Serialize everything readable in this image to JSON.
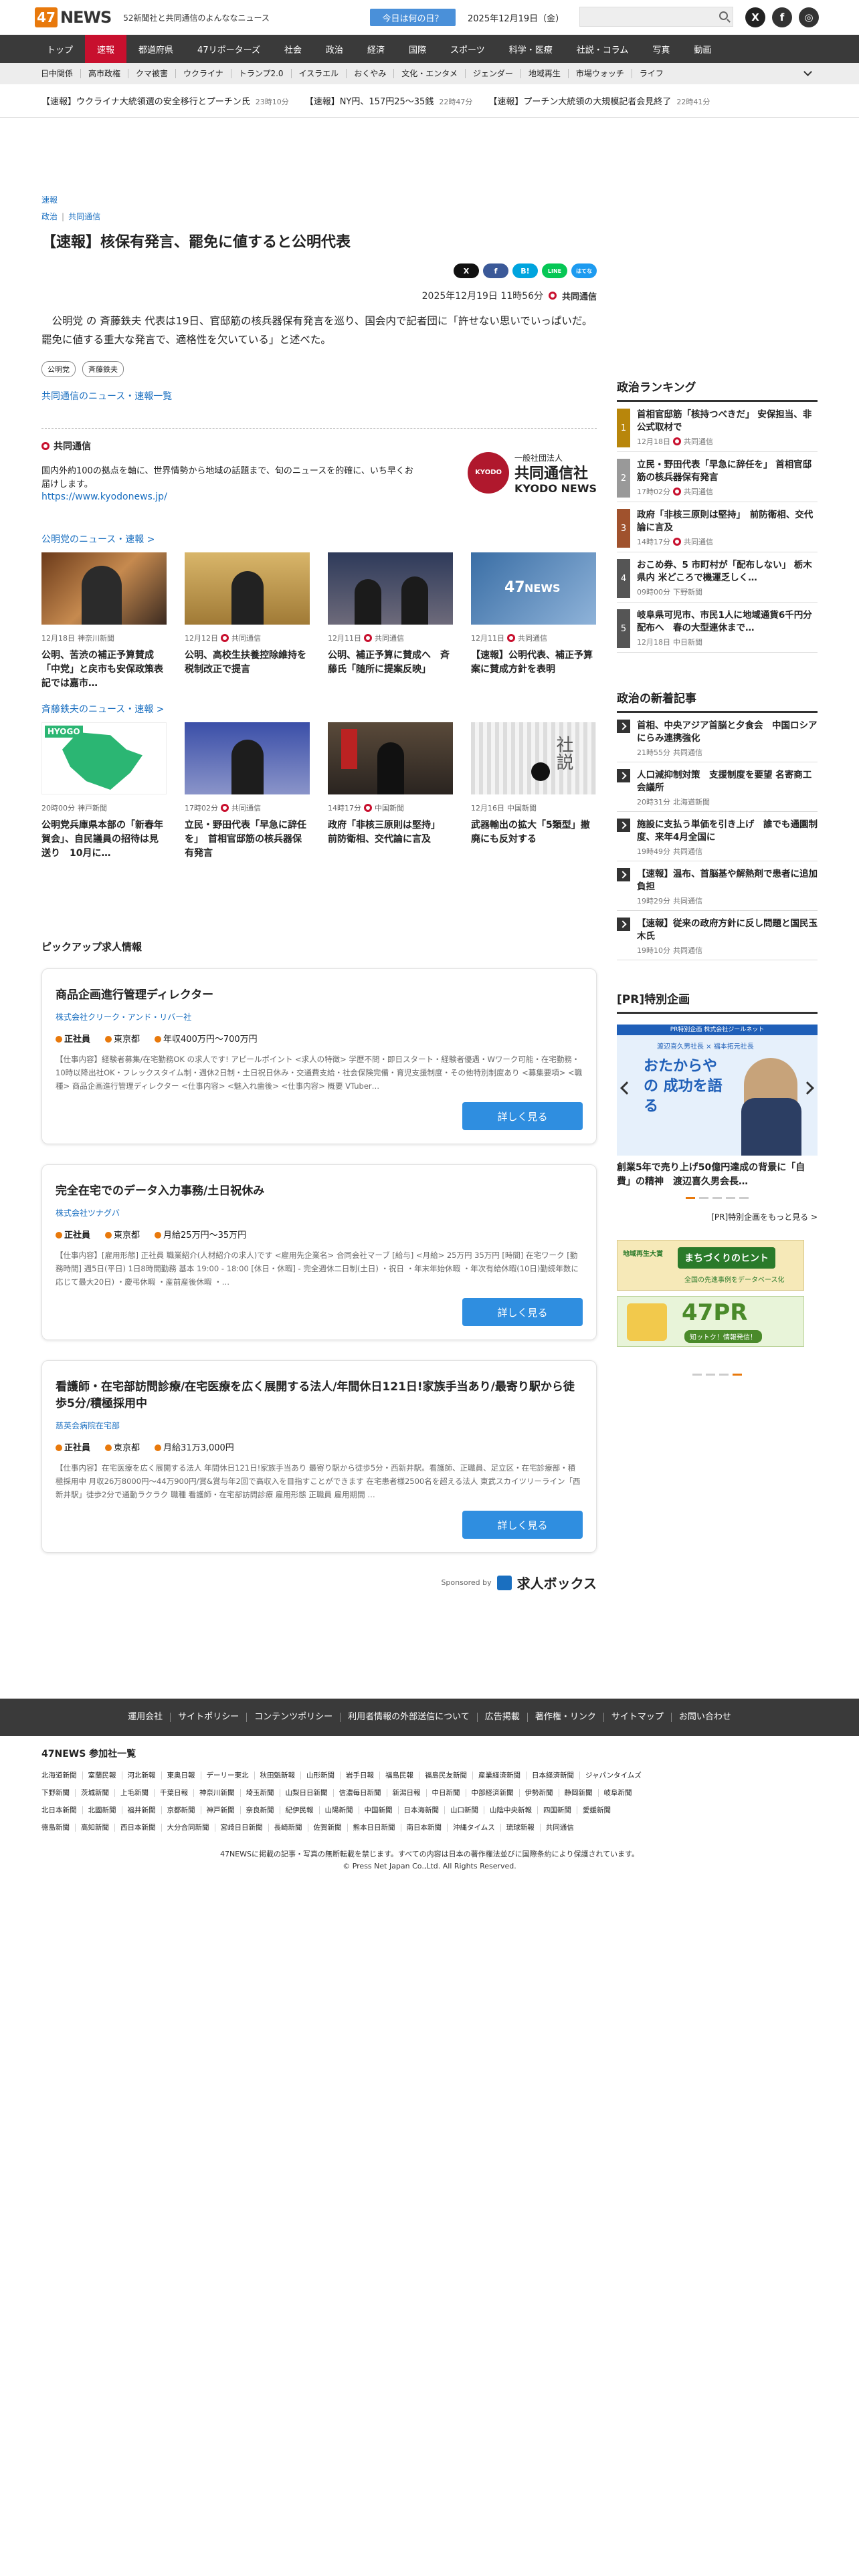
{
  "header": {
    "logo": "47",
    "logo_text": "NEWS",
    "tagline": "52新聞社と共同通信のよんななニュース",
    "today_button": "今日は何の日？",
    "date": "2025年12月19日（金）",
    "social": [
      "X",
      "f",
      "◎"
    ]
  },
  "gnav": [
    "トップ",
    "速報",
    "都道府県",
    "47リポーターズ",
    "社会",
    "政治",
    "経済",
    "国際",
    "スポーツ",
    "科学・医療",
    "社説・コラム",
    "写真",
    "動画"
  ],
  "subnav": [
    "日中関係",
    "高市政権",
    "クマ被害",
    "ウクライナ",
    "トランプ2.0",
    "イスラエル",
    "おくやみ",
    "文化・エンタメ",
    "ジェンダー",
    "地域再生",
    "市場ウォッチ",
    "ライフ"
  ],
  "ticker": [
    {
      "text": "【速報】ウクライナ大統領選の安全移行とプーチン氏",
      "time": "23時10分"
    },
    {
      "text": "【速報】NY円、157円25～35銭",
      "time": "22時47分"
    },
    {
      "text": "【速報】プーチン大統領の大規模記者会見終了",
      "time": "22時41分"
    }
  ],
  "article": {
    "category": "速報",
    "crumbs": [
      "政治",
      "共同通信"
    ],
    "title": "【速報】核保有発言、罷免に値すると公明代表",
    "share": [
      "X",
      "f",
      "B!",
      "LINE",
      "はてな"
    ],
    "date": "2025年12月19日 11時56分",
    "source": "共同通信",
    "body": "公明党 の 斉藤鉄夫 代表は19日、官邸筋の核兵器保有発言を巡り、国会内で記者団に「許せない思いでいっぱいだ。罷免に値する重大な発言で、適格性を欠いている」と述べた。",
    "tags": [
      "公明党",
      "斉藤鉄夫"
    ],
    "more": "共同通信のニュース・速報一覧"
  },
  "kyodo": {
    "title": "共同通信",
    "text": "国内外約100の拠点を軸に、世界情勢から地域の話題まで、旬のニュースを的確に、いち早くお届けします。",
    "url": "https://www.kyodonews.jp/",
    "logo_mark": "KYODO",
    "logo_prefix": "一般社団法人",
    "logo_name": "共同通信社",
    "logo_en": "KYODO NEWS"
  },
  "related1": {
    "heading": "公明党のニュース・速報 >",
    "items": [
      {
        "date": "12月18日",
        "source": "神奈川新聞",
        "title": "公明、苦渋の補正予算賛成 「中党」と戻市も安保政策表記では嘉市…"
      },
      {
        "date": "12月12日",
        "source": "共同通信",
        "title": "公明、高校生扶養控除維持を　税制改正で提言"
      },
      {
        "date": "12月11日",
        "source": "共同通信",
        "title": "公明、補正予算に賛成へ　斉藤氏「随所に提案反映」"
      },
      {
        "date": "12月11日",
        "source": "共同通信",
        "title": "【速報】公明代表、補正予算案に賛成方針を表明"
      }
    ]
  },
  "related2": {
    "heading": "斉藤鉄夫のニュース・速報 >",
    "items": [
      {
        "date": "20時00分",
        "source": "神戸新聞",
        "title": "公明党兵庫県本部の「新春年賀会」、自民議員の招待は見送り　10月に…",
        "thumb_label": "HYOGO"
      },
      {
        "date": "17時02分",
        "source": "共同通信",
        "title": "立民・野田代表「早急に辞任を」　首相官邸筋の核兵器保有発言",
        "thumb_label": ""
      },
      {
        "date": "14時17分",
        "source": "中国新聞",
        "title": "政府「非核三原則は堅持」　前防衛相、交代論に言及",
        "thumb_label": ""
      },
      {
        "date": "12月16日",
        "source": "中国新聞",
        "title": "武器輸出の拡大「5類型」撤廃にも反対する",
        "thumb_label": "社説"
      }
    ]
  },
  "jobs": {
    "heading": "ピックアップ求人情報",
    "items": [
      {
        "title": "商品企画進行管理ディレクター",
        "company": "株式会社クリーク・アンド・リバー社",
        "type": "正社員",
        "place": "東京都",
        "pay": "年収400万円〜700万円",
        "desc": "【仕事内容】経験者募集/在宅勤務OK の求人です! アピールポイント <求人の特徴> 学歴不問・即日スタート・経験者優遇・Wワーク可能・在宅勤務・10時以降出社OK・フレックスタイム制・週休2日制・土日祝日休み・交通費支給・社会保険完備・育児支援制度・その他特別制度あり <募集要項> <職種> 商品企画進行管理ディレクター <仕事内容> <魅入れ歯後> <仕事内容> 概要 VTuber…",
        "button": "詳しく見る"
      },
      {
        "title": "完全在宅でのデータ入力事務/土日祝休み",
        "company": "株式会社ツナグバ",
        "type": "正社員",
        "place": "東京都",
        "pay": "月給25万円〜35万円",
        "desc": "【仕事内容】[雇用形態] 正社員 職業紹介(人材紹介の求人)です <雇用先企業名> 合同会社マーブ [給与] <月給> 25万円 35万円 [時間] 在宅ワーク [勤務時間] 週5日(平日) 1日8時間勤務 基本 19:00 - 18:00 [休日・休暇] - 完全週休二日制(土日) ・祝日 ・年末年始休暇 ・年次有給休暇(10日)勤続年数に応じて最大20日) ・慶弔休暇 ・産前産後休暇 ・…",
        "button": "詳しく見る"
      },
      {
        "title": "看護師・在宅部訪問診療/在宅医療を広く展開する法人/年間休日121日!家族手当あり/最寄り駅から徒歩5分/積極採用中",
        "company": "慈英会病院在宅部",
        "type": "正社員",
        "place": "東京都",
        "pay": "月給31万3,000円",
        "desc": "【仕事内容】在宅医療を広く展開する法人 年間休日121日!家族手当あり 最寄り駅から徒歩5分・西新井駅。看護師、正職員、足立区・在宅診療部・積極採用中 月収26万8000円～44万900円/賞&賞与年2回で高収入を目指すことができます 在宅患者様2500名を超える法人 東武スカイツリーライン「西新井駅」徒歩2分で通勤ラクラク 職種 看護師・在宅部訪問診療 雇用形態 正職員 雇用期間 …",
        "button": "詳しく見る"
      }
    ],
    "sponsor_label": "Sponsored by",
    "sponsor_name": "求人ボックス"
  },
  "ranking": {
    "heading": "政治ランキング",
    "items": [
      {
        "rank": "1",
        "title": "首相官邸筋「核持つべきだ」 安保担当、非公式取材で",
        "time": "12月18日",
        "source": "共同通信"
      },
      {
        "rank": "2",
        "title": "立民・野田代表「早急に辞任を」 首相官邸筋の核兵器保有発言",
        "time": "17時02分",
        "source": "共同通信"
      },
      {
        "rank": "3",
        "title": "政府「非核三原則は堅持」　前防衛相、交代論に言及",
        "time": "14時17分",
        "source": "共同通信"
      },
      {
        "rank": "4",
        "title": "おこめ券、5 市町村が「配布しない」 栃木県内 米どころで機運乏しく…",
        "time": "09時00分",
        "source": "下野新聞"
      },
      {
        "rank": "5",
        "title": "岐阜県可児市、市民1人に地域通貨6千円分配布へ　春の大型連休まで…",
        "time": "12月18日",
        "source": "中日新聞"
      }
    ]
  },
  "newest": {
    "heading": "政治の新着記事",
    "items": [
      {
        "title": "首相、中央アジア首脳と夕食会　中国ロシアにらみ連携強化",
        "time": "21時55分",
        "source": "共同通信"
      },
      {
        "title": "人口減抑制対策　支援制度を要望 名寄商工会議所",
        "time": "20時31分",
        "source": "北海道新聞"
      },
      {
        "title": "施設に支払う単価を引き上げ　誰でも通園制度、来年4月全国に",
        "time": "19時49分",
        "source": "共同通信"
      },
      {
        "title": "【速報】温布、首脳基や解熱剤で患者に追加負担",
        "time": "19時29分",
        "source": "共同通信"
      },
      {
        "title": "【速報】従来の政府方針に反し問題と国民玉木氏",
        "time": "19時10分",
        "source": "共同通信"
      }
    ]
  },
  "pr": {
    "heading": "[PR]特別企画",
    "banner_top": "PR特別企画 株式会社ジールネット",
    "banner_name": "渡辺喜久男社長 × 福本拓元社長",
    "banner_main": "おたからや の 成功を語る",
    "title": "創業5年で売り上げ50億円達成の背景に「自費」の精神　渡辺喜久男会長…",
    "more": "[PR]特別企画をもっと見る >",
    "ad1": "まちづくりのヒント",
    "ad1_sub": "全国の先進事例をデータベース化",
    "ad1_tag": "地域再生大賞",
    "ad2": "47PR",
    "ad2_sub": "知ットク！情報発信！"
  },
  "footer": {
    "nav": [
      "運用会社",
      "サイトポリシー",
      "コンテンツポリシー",
      "利用者情報の外部送信について",
      "広告掲載",
      "著作権・リンク",
      "サイトマップ",
      "お問い合わせ"
    ],
    "papers_heading": "47NEWS 参加社一覧",
    "papers1": [
      "北海道新聞",
      "室蘭民報",
      "河北新報",
      "東奥日報",
      "デーリー東北",
      "秋田魁新報",
      "山形新聞",
      "岩手日報",
      "福島民報",
      "福島民友新聞",
      "産業経済新聞",
      "日本経済新聞",
      "ジャパンタイムズ"
    ],
    "papers2": [
      "下野新聞",
      "茨城新聞",
      "上毛新聞",
      "千葉日報",
      "神奈川新聞",
      "埼玉新聞",
      "山梨日日新聞",
      "信濃毎日新聞",
      "新潟日報",
      "中日新聞",
      "中部経済新聞",
      "伊勢新聞",
      "静岡新聞",
      "岐阜新聞"
    ],
    "papers3": [
      "北日本新聞",
      "北國新聞",
      "福井新聞",
      "京都新聞",
      "神戸新聞",
      "奈良新聞",
      "紀伊民報",
      "山陽新聞",
      "中国新聞",
      "日本海新聞",
      "山口新聞",
      "山陰中央新報",
      "四国新聞",
      "愛媛新聞"
    ],
    "papers4": [
      "徳島新聞",
      "高知新聞",
      "西日本新聞",
      "大分合同新聞",
      "宮崎日日新聞",
      "長崎新聞",
      "佐賀新聞",
      "熊本日日新聞",
      "南日本新聞",
      "沖縄タイムス",
      "琉球新報",
      "共同通信"
    ],
    "copy1": "47NEWSに掲載の記事・写真の無断転載を禁じます。すべての内容は日本の著作権法並びに国際条約により保護されています。",
    "copy2": "© Press Net Japan Co.,Ltd. All Rights Reserved."
  }
}
